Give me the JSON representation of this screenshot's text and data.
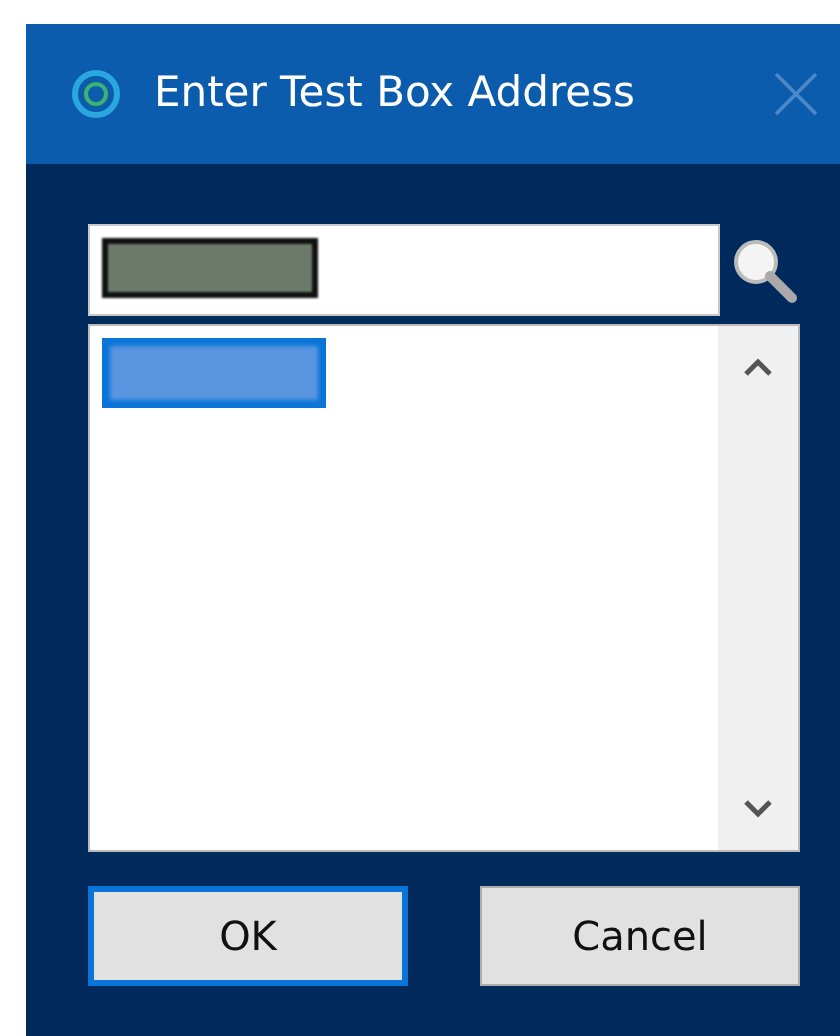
{
  "window": {
    "title": "Enter Test Box Address"
  },
  "address_field": {
    "redacted": true
  },
  "list": {
    "items": [
      {
        "redacted": true,
        "selected": true
      }
    ]
  },
  "buttons": [
    {
      "label": "OK",
      "focused": true
    },
    {
      "label": "Cancel",
      "focused": false
    }
  ]
}
